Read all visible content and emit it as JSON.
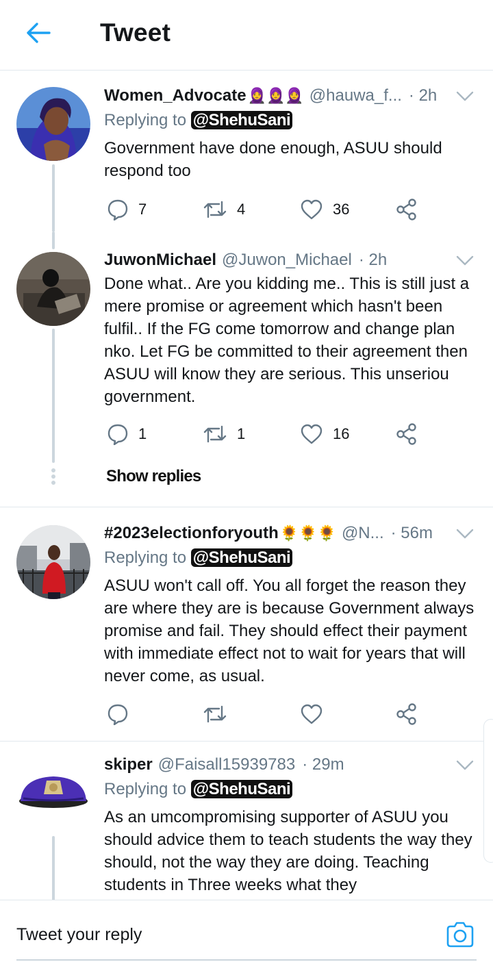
{
  "header": {
    "title": "Tweet"
  },
  "tweets": [
    {
      "name": "Women_Advocate",
      "emoji": "🧕🧕🧕",
      "handle": "@hauwa_f...",
      "time": "· 2h",
      "replying_prefix": "Replying to ",
      "replying_to": "@ShehuSani",
      "text": "Government have done enough, ASUU should respond too",
      "replies": "7",
      "retweets": "4",
      "likes": "36"
    },
    {
      "name": "JuwonMichael",
      "emoji": "",
      "handle": "@Juwon_Michael",
      "time": "· 2h",
      "text": "Done what.. Are you kidding me.. This is still just a mere promise or agreement which hasn't been fulfil.. If the FG come tomorrow and change plan nko. Let FG be committed to their agreement then ASUU will know they are serious. This unseriou government.",
      "replies": "1",
      "retweets": "1",
      "likes": "16",
      "show_replies": "Show replies"
    },
    {
      "name": "#2023electionforyouth",
      "emoji": "🌻🌻🌻",
      "handle": "@N...",
      "time": "· 56m",
      "replying_prefix": "Replying to ",
      "replying_to": "@ShehuSani",
      "text": "ASUU won't call off. You all forget the reason they are where they are is because Government always promise and fail. They should effect their payment with immediate effect not to wait for years that will never come, as usual.",
      "replies": "",
      "retweets": "",
      "likes": ""
    },
    {
      "name": "skiper",
      "emoji": "",
      "handle": "@Faisall15939783",
      "time": "· 29m",
      "replying_prefix": "Replying to ",
      "replying_to": "@ShehuSani",
      "text": "As an umcompromising supporter of ASUU you should advice them to teach students the way they should, not the way they are doing. Teaching students in Three weeks what they"
    }
  ],
  "reply_bar": {
    "placeholder": "Tweet your reply"
  },
  "colors": {
    "accent": "#1da1f2",
    "icon_gray": "#657786",
    "divider": "#e1e8ed"
  }
}
